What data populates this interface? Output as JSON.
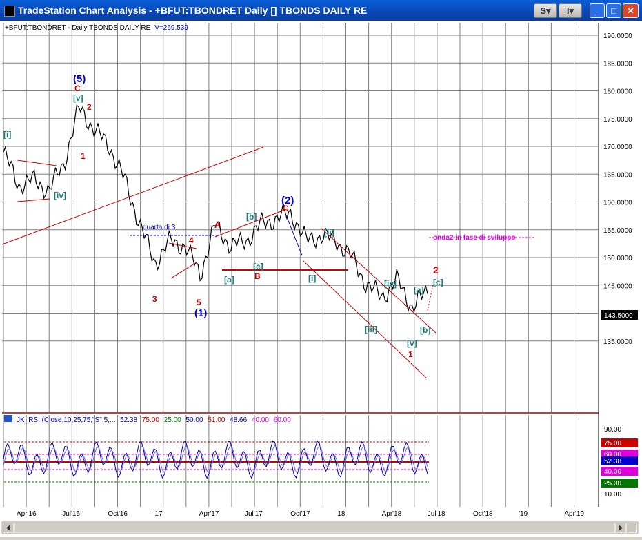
{
  "window": {
    "title": "TradeStation Chart Analysis - +BFUT:TBONDRET Daily [] TBONDS DAILY RE",
    "btn_s": "S",
    "btn_i": "I",
    "chevron": "▾",
    "min_symbol": "_",
    "max_symbol": "□",
    "close_symbol": "✕"
  },
  "colors": {
    "title_bar": "#0a5fd8",
    "price": "#000000",
    "trendline": "#cc0000",
    "wave_blue": "#0000cc",
    "wave_red": "#cc0000",
    "wave_teal": "#1a7a7a",
    "annotation_magenta": "#dd00dd",
    "grid": "#808080"
  },
  "chart_header": {
    "symbol": "+BFUT:TBONDRET - Daily  TBONDS DAILY RE",
    "volume": "V=269,539"
  },
  "price_axis": {
    "labels": [
      "190.0000",
      "185.0000",
      "180.0000",
      "175.0000",
      "170.0000",
      "165.0000",
      "160.0000",
      "155.0000",
      "150.0000",
      "145.0000",
      "140.0000",
      "135.0000"
    ],
    "last_price": "143.5000"
  },
  "rsi_header": {
    "name": "JK_RSI (Close,10,25,75,\"S\",5,...",
    "values": [
      "52.38",
      "75.00",
      "25.00",
      "50.00",
      "51.00",
      "48.66",
      "40.00",
      "60.00"
    ]
  },
  "rsi_axis": {
    "labels": [
      "90.00",
      "10.00"
    ],
    "badges": [
      "75.00",
      "60.00",
      "52.38",
      "40.00",
      "25.00"
    ]
  },
  "time_axis": {
    "labels": [
      "Apr'16",
      "Jul'16",
      "Oct'16",
      "'17",
      "Apr'17",
      "Jul'17",
      "Oct'17",
      "'18",
      "Apr'18",
      "Jul'18",
      "Oct'18",
      "'19",
      "Apr'19"
    ]
  },
  "annotations": {
    "wave_5": "(5)",
    "wave_1": "(1)",
    "wave_2": "(2)",
    "quarta": "quarta di 3",
    "onda2": "onda2 in fase di sviluppo",
    "labels": [
      "[i]",
      "C",
      "[v]",
      "2",
      "1",
      "[iv]",
      "3",
      "4",
      "5",
      "A",
      "[b]",
      "[a]",
      "[c]",
      "B",
      "C",
      "[ii]",
      "[i]",
      "[iii]",
      "[iv]",
      "[a]",
      "[v]",
      "1",
      "[b]",
      "2",
      "[c]"
    ]
  },
  "chart_data": {
    "type": "line",
    "series": [
      {
        "x": [
          "Feb'16",
          "Mar'16",
          "Apr'16",
          "May'16",
          "Jun'16",
          "Jul'16",
          "Aug'16",
          "Sep'16",
          "Oct'16",
          "Nov'16",
          "Dec'16",
          "Jan'17",
          "Feb'17",
          "Mar'17",
          "Apr'17",
          "May'17",
          "Jun'17",
          "Jul'17",
          "Aug'17",
          "Sep'17",
          "Oct'17",
          "Nov'17",
          "Dec'17",
          "Jan'18",
          "Feb'18",
          "Mar'18",
          "Apr'18",
          "May'18",
          "Jun'18"
        ],
        "values": [
          169,
          163,
          164,
          162,
          167,
          177,
          173,
          170,
          164,
          156,
          149,
          153,
          152,
          147,
          156,
          152,
          153,
          156,
          157,
          158,
          153,
          154,
          153,
          150,
          145,
          143,
          146,
          141,
          144
        ]
      }
    ],
    "ylim": [
      130,
      192
    ],
    "grid": true,
    "rsi_levels": [
      75,
      60,
      50,
      40,
      25
    ]
  }
}
